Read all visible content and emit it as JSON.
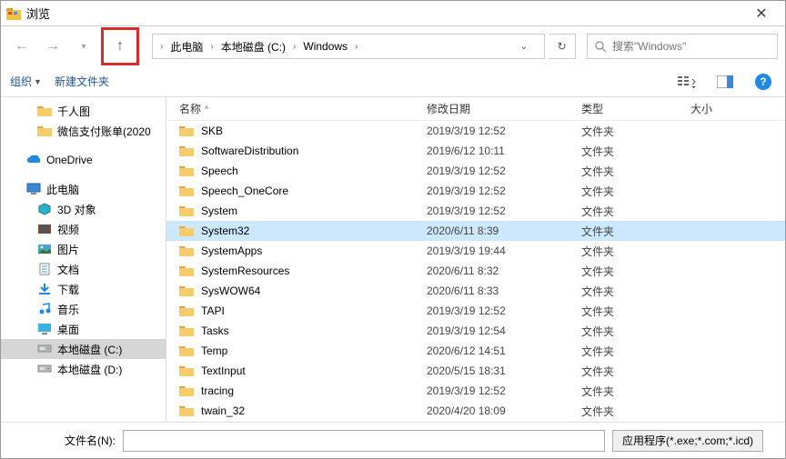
{
  "window": {
    "title": "浏览"
  },
  "breadcrumb": {
    "items": [
      "此电脑",
      "本地磁盘 (C:)",
      "Windows"
    ]
  },
  "search": {
    "placeholder": "搜索\"Windows\""
  },
  "toolbar": {
    "organize": "组织",
    "new_folder": "新建文件夹"
  },
  "columns": {
    "name": "名称",
    "date": "修改日期",
    "type": "类型",
    "size": "大小"
  },
  "sidebar": {
    "items": [
      {
        "label": "千人图",
        "icon": "folder",
        "level": 2
      },
      {
        "label": "微信支付账单(2020",
        "icon": "folder",
        "level": 2
      },
      {
        "label": "",
        "spacer": true
      },
      {
        "label": "OneDrive",
        "icon": "onedrive",
        "level": 1
      },
      {
        "label": "",
        "spacer": true
      },
      {
        "label": "此电脑",
        "icon": "thispc",
        "level": 1
      },
      {
        "label": "3D 对象",
        "icon": "3d",
        "level": 2
      },
      {
        "label": "视频",
        "icon": "video",
        "level": 2
      },
      {
        "label": "图片",
        "icon": "pictures",
        "level": 2
      },
      {
        "label": "文档",
        "icon": "documents",
        "level": 2
      },
      {
        "label": "下载",
        "icon": "downloads",
        "level": 2
      },
      {
        "label": "音乐",
        "icon": "music",
        "level": 2
      },
      {
        "label": "桌面",
        "icon": "desktop",
        "level": 2
      },
      {
        "label": "本地磁盘 (C:)",
        "icon": "drive",
        "level": 2,
        "selected": true
      },
      {
        "label": "本地磁盘 (D:)",
        "icon": "drive",
        "level": 2
      }
    ]
  },
  "files": [
    {
      "name": "SKB",
      "date": "2019/3/19 12:52",
      "type": "文件夹"
    },
    {
      "name": "SoftwareDistribution",
      "date": "2019/6/12 10:11",
      "type": "文件夹"
    },
    {
      "name": "Speech",
      "date": "2019/3/19 12:52",
      "type": "文件夹"
    },
    {
      "name": "Speech_OneCore",
      "date": "2019/3/19 12:52",
      "type": "文件夹"
    },
    {
      "name": "System",
      "date": "2019/3/19 12:52",
      "type": "文件夹"
    },
    {
      "name": "System32",
      "date": "2020/6/11 8:39",
      "type": "文件夹",
      "selected": true
    },
    {
      "name": "SystemApps",
      "date": "2019/3/19 19:44",
      "type": "文件夹"
    },
    {
      "name": "SystemResources",
      "date": "2020/6/11 8:32",
      "type": "文件夹"
    },
    {
      "name": "SysWOW64",
      "date": "2020/6/11 8:33",
      "type": "文件夹"
    },
    {
      "name": "TAPI",
      "date": "2019/3/19 12:52",
      "type": "文件夹"
    },
    {
      "name": "Tasks",
      "date": "2019/3/19 12:54",
      "type": "文件夹"
    },
    {
      "name": "Temp",
      "date": "2020/6/12 14:51",
      "type": "文件夹"
    },
    {
      "name": "TextInput",
      "date": "2020/5/15 18:31",
      "type": "文件夹"
    },
    {
      "name": "tracing",
      "date": "2019/3/19 12:52",
      "type": "文件夹"
    },
    {
      "name": "twain_32",
      "date": "2020/4/20 18:09",
      "type": "文件夹"
    }
  ],
  "bottom": {
    "filename_label": "文件名(N):",
    "filter": "应用程序(*.exe;*.com;*.icd)"
  }
}
